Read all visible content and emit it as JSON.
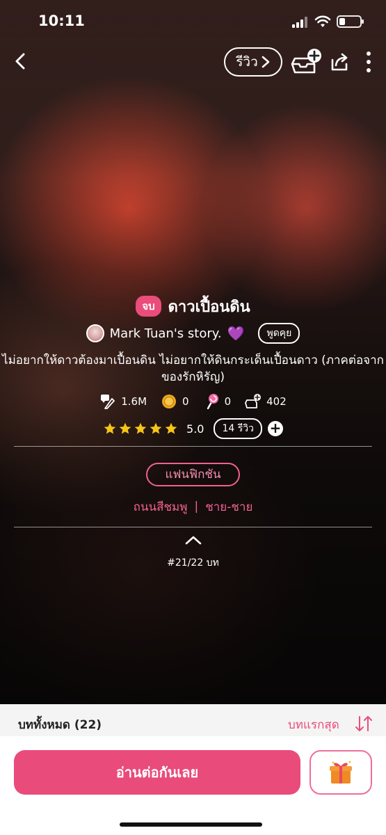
{
  "status_bar": {
    "time": "10:11",
    "battery_level": 0.3
  },
  "top_bar": {
    "review_label": "รีวิว"
  },
  "story": {
    "status_badge": "จบ",
    "title": "ดาวเปื้อนดิน",
    "author": "Mark Tuan's story.",
    "author_emoji": "💜",
    "talk_label": "พูดคุย",
    "description": "ไม่อยากให้ดาวต้องมาเปื้อนดิน ไม่อยากให้ดินกระเด็นเปื้อนดาว (ภาคต่อจากของรักหิรัญ)"
  },
  "stats": {
    "views": "1.6M",
    "coins": "0",
    "lollipops": "0",
    "shelf_adds": "402"
  },
  "rating": {
    "stars": 5,
    "score": "5.0",
    "review_count_label": "14 รีวิว"
  },
  "category": {
    "label": "แฟนฟิกชัน",
    "tag_1": "ถนนสีชมพู",
    "separator": "|",
    "tag_2": "ชาย-ชาย"
  },
  "progress": {
    "label": "#21/22 บท"
  },
  "chapters": {
    "total_label": "บททั้งหมด (22)",
    "sort_label": "บทแรกสุด"
  },
  "actions": {
    "read_label": "อ่านต่อกันเลย"
  },
  "colors": {
    "accent": "#e94b7b",
    "star": "#f5c518"
  }
}
